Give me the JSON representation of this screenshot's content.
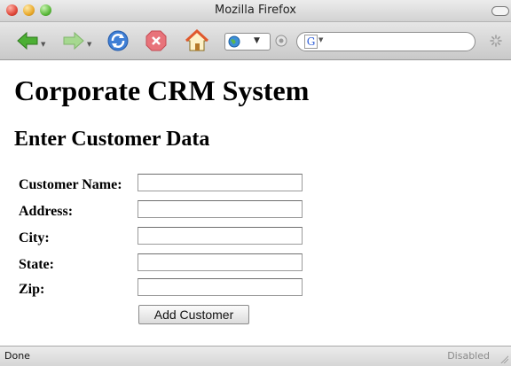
{
  "window": {
    "title": "Mozilla Firefox"
  },
  "toolbar": {
    "icons": [
      "back-arrow-icon",
      "forward-arrow-icon",
      "reload-icon",
      "stop-icon",
      "home-icon",
      "globe-icon",
      "go-icon",
      "google-search-icon",
      "throbber-icon"
    ],
    "search_engine_glyph": "G"
  },
  "page": {
    "title": "Corporate CRM System",
    "section_title": "Enter Customer Data",
    "form": {
      "fields": [
        {
          "label": "Customer Name:",
          "value": ""
        },
        {
          "label": "Address:",
          "value": ""
        },
        {
          "label": "City:",
          "value": ""
        },
        {
          "label": "State:",
          "value": ""
        },
        {
          "label": "Zip:",
          "value": ""
        }
      ],
      "submit_label": "Add Customer"
    }
  },
  "status": {
    "left": "Done",
    "right": "Disabled"
  },
  "colors": {
    "back_arrow": "#4caf34",
    "forward_arrow": "#a6d890",
    "reload": "#3f7fd6",
    "stop": "#e8737a",
    "home_roof": "#e0582c"
  }
}
